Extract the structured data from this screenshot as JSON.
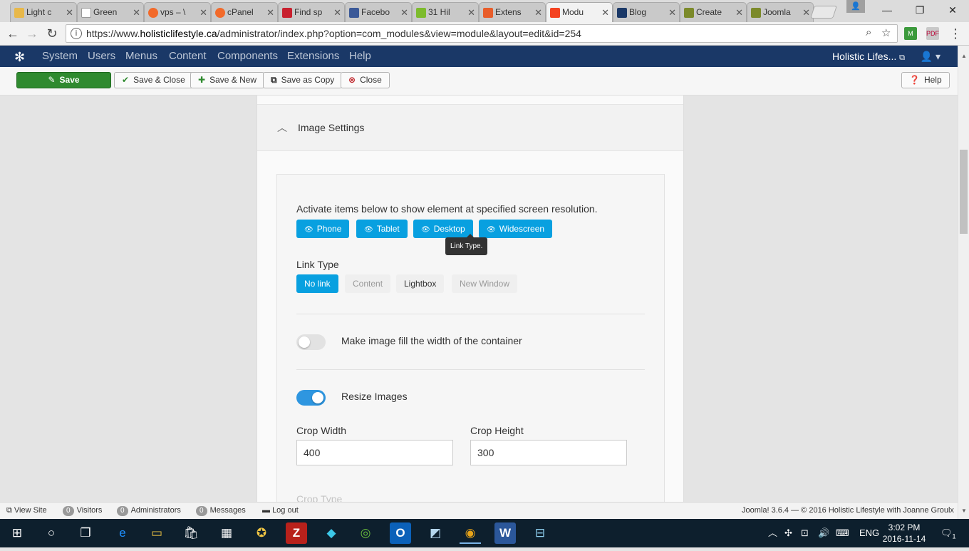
{
  "browser": {
    "tabs": [
      {
        "label": "Light c",
        "color": "#e8b84a"
      },
      {
        "label": "Green",
        "color": "#9e9e9e"
      },
      {
        "label": "vps – \\",
        "color": "#f26a2a"
      },
      {
        "label": "cPanel",
        "color": "#f26a2a"
      },
      {
        "label": "Find sp",
        "color": "#c8202e"
      },
      {
        "label": "Facebo",
        "color": "#3b5998"
      },
      {
        "label": "31 Hil",
        "color": "#7dbb2d"
      },
      {
        "label": "Extens",
        "color": "#e85d2a"
      },
      {
        "label": "Modu",
        "color": "#f44321"
      },
      {
        "label": "Blog",
        "color": "#1a3867"
      },
      {
        "label": "Create",
        "color": "#7c8a2a"
      },
      {
        "label": "Joomla",
        "color": "#7c8a2a"
      }
    ],
    "active_tab": 8,
    "url_prefix": "https://www.",
    "url_host": "holisticlifestyle.ca",
    "url_path": "/administrator/index.php?option=com_modules&view=module&layout=edit&id=254"
  },
  "joomla": {
    "menu": [
      "System",
      "Users",
      "Menus",
      "Content",
      "Components",
      "Extensions",
      "Help"
    ],
    "site_name": "Holistic Lifes...",
    "toolbar": {
      "save": "Save",
      "save_close": "Save & Close",
      "save_new": "Save & New",
      "save_copy": "Save as Copy",
      "close": "Close",
      "help": "Help"
    }
  },
  "panel": {
    "title": "Image Settings",
    "description": "Activate items below to show element at specified screen resolution.",
    "resolutions": [
      "Phone",
      "Tablet",
      "Desktop",
      "Widescreen"
    ],
    "tooltip": "Link Type.",
    "link_type_label": "Link Type",
    "link_types": [
      "No link",
      "Content",
      "Lightbox",
      "New Window"
    ],
    "link_type_selected": "No link",
    "fill_width_label": "Make image fill the width of the container",
    "fill_width_on": false,
    "resize_label": "Resize Images",
    "resize_on": true,
    "crop_width_label": "Crop Width",
    "crop_width_value": "400",
    "crop_height_label": "Crop Height",
    "crop_height_value": "300",
    "crop_type_label": "Crop Type"
  },
  "statusbar": {
    "view_site": "View Site",
    "visitors_count": "0",
    "visitors": "Visitors",
    "admins_count": "0",
    "admins": "Administrators",
    "messages_count": "0",
    "messages": "Messages",
    "logout": "Log out",
    "version": "Joomla! 3.6.4",
    "copyright": "© 2016 Holistic Lifestyle with Joanne Groulx"
  },
  "taskbar": {
    "lang": "ENG",
    "time": "3:02 PM",
    "date": "2016-11-14",
    "notifications": "1"
  }
}
